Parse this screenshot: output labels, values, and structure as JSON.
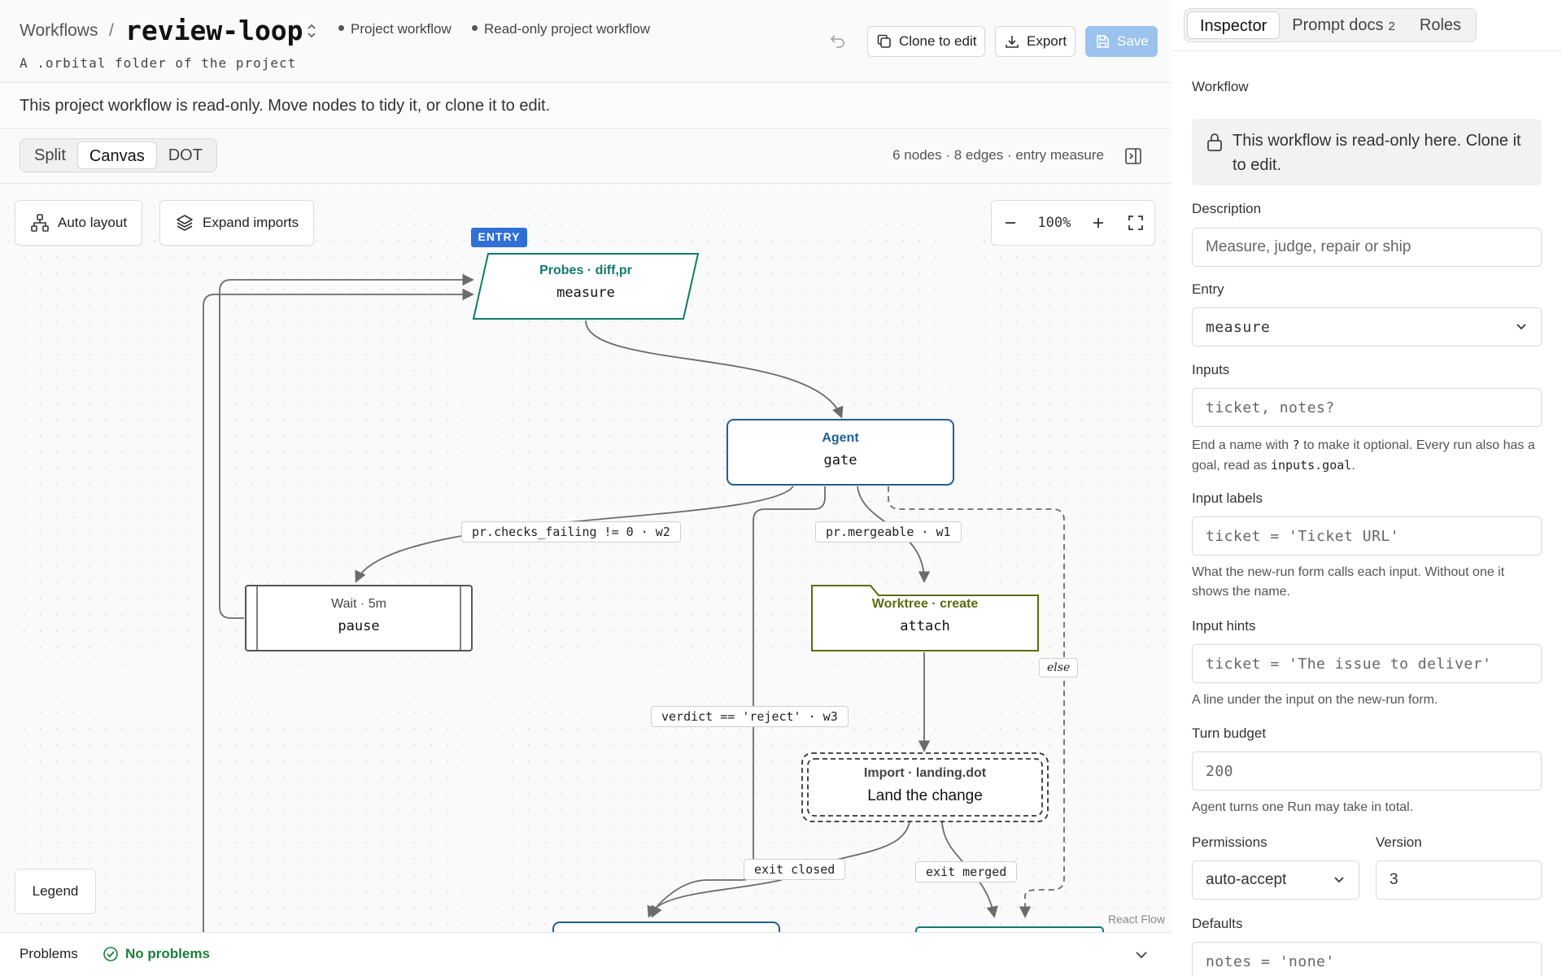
{
  "header": {
    "breadcrumb": "Workflows",
    "separator": "/",
    "title": "review-loop",
    "badge_1": "Project workflow",
    "badge_2": "Read-only project workflow",
    "subtitle": "A .orbital folder of the project",
    "clone_label": "Clone to edit",
    "export_label": "Export",
    "save_label": "Save"
  },
  "notice": "This project workflow is read-only. Move nodes to tidy it, or clone it to edit.",
  "viewbar": {
    "modes": [
      "Split",
      "Canvas",
      "DOT"
    ],
    "active_mode": "Canvas",
    "stats": "6 nodes · 8 edges · entry measure"
  },
  "canvas": {
    "auto_layout_label": "Auto layout",
    "expand_imports_label": "Expand imports",
    "zoom": "100%",
    "legend_label": "Legend",
    "attribution": "React Flow",
    "entry_badge": "ENTRY",
    "nodes": {
      "measure": {
        "kind": "Probes · diff,pr",
        "name": "measure"
      },
      "gate": {
        "kind": "Agent",
        "name": "gate"
      },
      "pause": {
        "kind": "Wait · 5m",
        "name": "pause"
      },
      "attach": {
        "kind": "Worktree · create",
        "name": "attach"
      },
      "land": {
        "kind": "Import · landing.dot",
        "name": "Land the change"
      }
    },
    "edge_labels": {
      "checks_failing": "pr.checks_failing != 0 · w2",
      "mergeable": "pr.mergeable · w1",
      "else": "else",
      "reject": "verdict == 'reject' · w3",
      "exit_closed": "exit closed",
      "exit_merged": "exit merged"
    },
    "colors": {
      "probes": "#0f7b6c",
      "agent": "#1f5f99",
      "worktree": "#5a6b10",
      "edge": "#6b6b6b",
      "entry_badge": "#2f6fd6"
    }
  },
  "problems": {
    "title": "Problems",
    "status": "No problems"
  },
  "inspector": {
    "tabs": [
      "Inspector",
      "Prompt docs",
      "Roles"
    ],
    "prompt_docs_count": "2",
    "section_title": "Workflow",
    "readonly_notice": "This workflow is read-only here. Clone it to edit.",
    "description_label": "Description",
    "description_placeholder": "Measure, judge, repair or ship",
    "entry_label": "Entry",
    "entry_value": "measure",
    "inputs_label": "Inputs",
    "inputs_placeholder": "ticket, notes?",
    "inputs_help_1": "End a name with",
    "inputs_help_code_1": "?",
    "inputs_help_2": "to make it optional. Every run also has a goal, read as",
    "inputs_help_code_2": "inputs.goal",
    "inputs_help_3": ".",
    "input_labels_label": "Input labels",
    "input_labels_placeholder": "ticket = 'Ticket URL'",
    "input_labels_help": "What the new-run form calls each input. Without one it shows the name.",
    "input_hints_label": "Input hints",
    "input_hints_placeholder": "ticket = 'The issue to deliver'",
    "input_hints_help": "A line under the input on the new-run form.",
    "turn_budget_label": "Turn budget",
    "turn_budget_placeholder": "200",
    "turn_budget_help": "Agent turns one Run may take in total.",
    "permissions_label": "Permissions",
    "permissions_value": "auto-accept",
    "version_label": "Version",
    "version_value": "3",
    "defaults_label": "Defaults",
    "defaults_placeholder": "notes = 'none'"
  }
}
